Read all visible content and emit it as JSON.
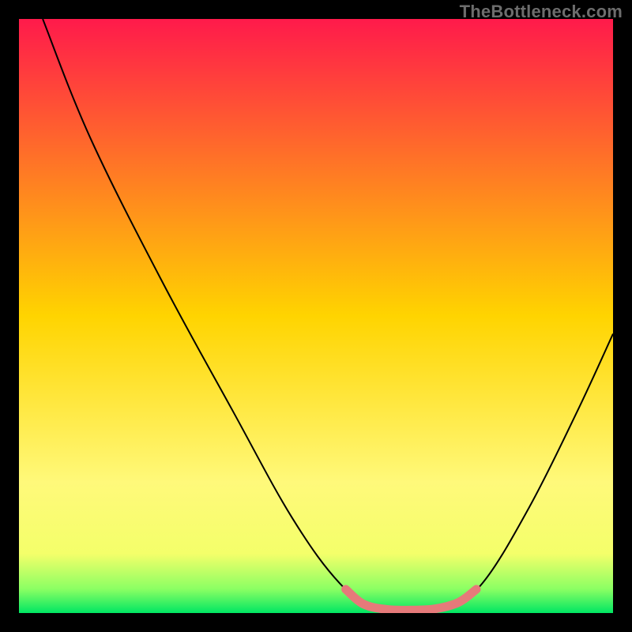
{
  "watermark": "TheBottleneck.com",
  "chart_data": {
    "type": "line",
    "title": "",
    "xlabel": "",
    "ylabel": "",
    "xlim": [
      0,
      100
    ],
    "ylim": [
      0,
      100
    ],
    "grid": false,
    "background_gradient": {
      "stops": [
        {
          "offset": 0.0,
          "color": "#ff1a4b"
        },
        {
          "offset": 0.5,
          "color": "#ffd400"
        },
        {
          "offset": 0.78,
          "color": "#fff97a"
        },
        {
          "offset": 0.9,
          "color": "#f4ff6a"
        },
        {
          "offset": 0.96,
          "color": "#8aff63"
        },
        {
          "offset": 1.0,
          "color": "#00e663"
        }
      ]
    },
    "series": [
      {
        "name": "bottleneck-curve",
        "color": "#000000",
        "width": 2,
        "points": [
          {
            "x": 4,
            "y": 100
          },
          {
            "x": 12,
            "y": 80
          },
          {
            "x": 24,
            "y": 56
          },
          {
            "x": 36,
            "y": 34
          },
          {
            "x": 46,
            "y": 16
          },
          {
            "x": 54,
            "y": 5
          },
          {
            "x": 60,
            "y": 1
          },
          {
            "x": 66,
            "y": 0.5
          },
          {
            "x": 72,
            "y": 1
          },
          {
            "x": 78,
            "y": 5
          },
          {
            "x": 86,
            "y": 18
          },
          {
            "x": 94,
            "y": 34
          },
          {
            "x": 100,
            "y": 47
          }
        ]
      },
      {
        "name": "optimal-band",
        "color": "#e67a7a",
        "width": 11,
        "linecap": "round",
        "points": [
          {
            "x": 55,
            "y": 4
          },
          {
            "x": 58,
            "y": 1.5
          },
          {
            "x": 62,
            "y": 0.6
          },
          {
            "x": 66,
            "y": 0.5
          },
          {
            "x": 70,
            "y": 0.7
          },
          {
            "x": 74,
            "y": 1.8
          },
          {
            "x": 77,
            "y": 4
          }
        ]
      }
    ]
  }
}
